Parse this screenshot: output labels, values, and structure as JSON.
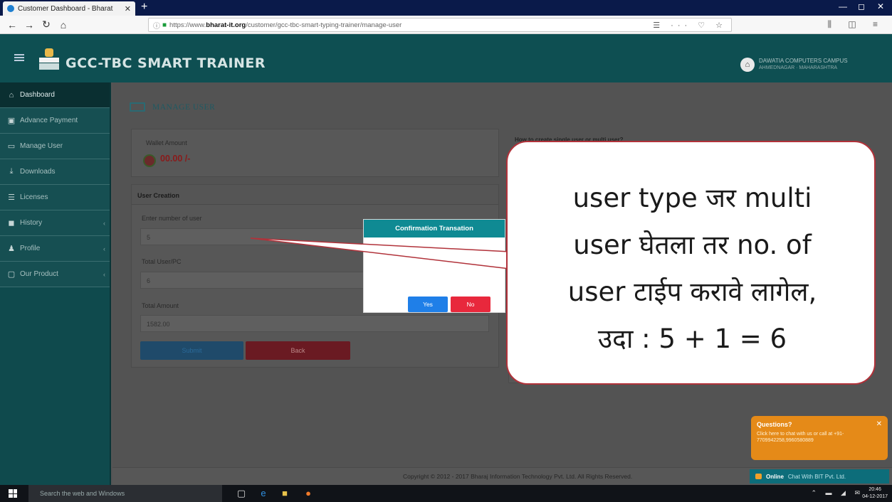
{
  "browser": {
    "tab_title": "Customer Dashboard - Bharat",
    "url_prefix": "https://www.",
    "url_host": "bharat-it.org",
    "url_path": "/customer/gcc-tbc-smart-typing-trainer/manage-user",
    "url_tools": "☰ ··· ♡ ☆",
    "right_icons": "⫼ ◫ ≡"
  },
  "header": {
    "brand": "GCC-TBC SMART TRAINER",
    "user_line1": "DAWATIA COMPUTERS CAMPUS",
    "user_line2": "AHMEDNAGAR · MAHARASHTRA"
  },
  "sidebar": {
    "items": [
      {
        "label": "Dashboard"
      },
      {
        "label": "Advance Payment"
      },
      {
        "label": "Manage User"
      },
      {
        "label": "Downloads"
      },
      {
        "label": "Licenses"
      },
      {
        "label": "History"
      },
      {
        "label": "Profile"
      },
      {
        "label": "Our Product"
      }
    ]
  },
  "main": {
    "page_title": "MANAGE USER",
    "wallet_label": "Wallet Amount",
    "wallet_amount": "00.00 /-",
    "howto": "How to create single user or multi user?",
    "user_creation": {
      "title": "User Creation",
      "f1_label": "Enter number of user",
      "f1_value": "5",
      "f2_label": "Total User/PC",
      "f2_value": "6",
      "f3_label": "Total Amount",
      "f3_value": "1582.00",
      "submit": "Submit",
      "back": "Back"
    }
  },
  "dialog": {
    "title": "Confirmation Transation",
    "yes": "Yes",
    "no": "No"
  },
  "callout": {
    "line1": "user type जर multi",
    "line2": "user घेतला तर no. of",
    "line3": "user टाईप करावे लागेल,",
    "line4": "उदा : 5 + 1 = 6"
  },
  "footer": {
    "copyright": "Copyright © 2012 - 2017 Bharaj Information Technology Pvt. Ltd. All Rights Reserved."
  },
  "chat": {
    "question": "Questions?",
    "text": "Click here to chat with us or call at +91-7709942258,9960580889",
    "online": "Online",
    "bar_text": "Chat With BIT Pvt. Ltd."
  },
  "taskbar": {
    "search_placeholder": "Search the web and Windows",
    "time": "20:46",
    "date": "04-12-2017"
  }
}
